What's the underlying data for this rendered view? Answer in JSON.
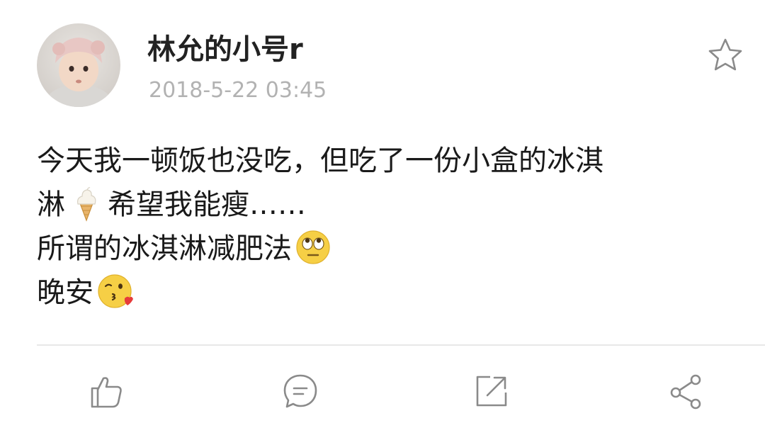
{
  "post": {
    "username": "林允的小号r",
    "timestamp": "2018-5-22 03:45",
    "lines": [
      {
        "before": "今天我一顿饭也没吃，但吃了一份小盒的冰淇",
        "emoji": "",
        "after": ""
      },
      {
        "before": "淋",
        "emoji": "ice-cream-icon",
        "after": "希望我能瘦……"
      },
      {
        "before": "所谓的冰淇淋减肥法",
        "emoji": "face-with-rolling-eyes-icon",
        "after": ""
      },
      {
        "before": "晚安",
        "emoji": "kissing-face-icon",
        "after": ""
      }
    ]
  },
  "header_actions": {
    "favorite_icon": "star-outline-icon"
  },
  "toolbar": {
    "icons": [
      "thumbs-up-icon",
      "comment-icon",
      "repost-icon",
      "share-icon"
    ]
  },
  "colors": {
    "username": "#222222",
    "timestamp": "#b2b2b2",
    "text": "#1a1a1a",
    "icon_stroke": "#8a8a8a",
    "divider": "#e8e8e8"
  }
}
